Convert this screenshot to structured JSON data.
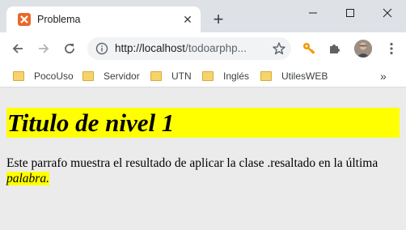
{
  "browser": {
    "tab_title": "Problema",
    "url_host": "http://localhost",
    "url_path": "/todoarphp...",
    "bookmarks": [
      {
        "label": "PocoUso"
      },
      {
        "label": "Servidor"
      },
      {
        "label": "UTN"
      },
      {
        "label": "Inglés"
      },
      {
        "label": "UtilesWEB"
      }
    ],
    "bookmarks_more": "»",
    "new_tab_symbol": "+",
    "tab_close_symbol": "✕"
  },
  "page": {
    "heading": "Titulo de nivel 1",
    "paragraph_text": "Este parrafo muestra el resultado de aplicar la clase .resaltado en la última ",
    "highlighted_word": "palabra",
    "paragraph_end": "."
  },
  "colors": {
    "highlight": "#ffff00",
    "page_background": "#ebebeb",
    "tab_favicon": "#e8692b"
  }
}
